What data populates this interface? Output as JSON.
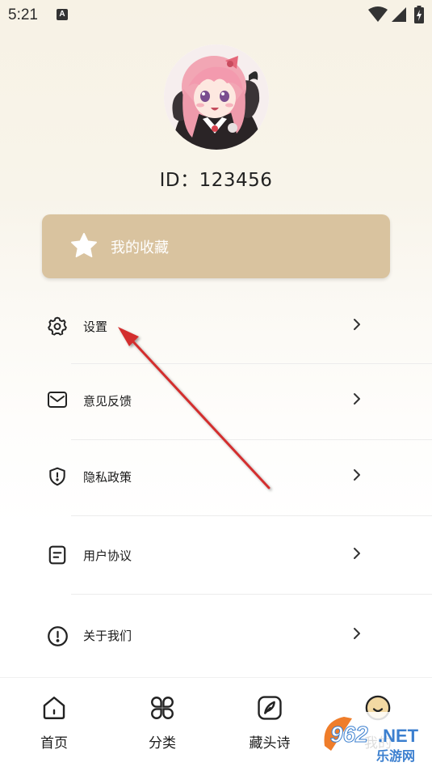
{
  "status_bar": {
    "time": "5:21",
    "notification_glyph": "A"
  },
  "profile": {
    "id_text": "ID：123456"
  },
  "favorites_card": {
    "label": "我的收藏",
    "color": "#d9c39f"
  },
  "menu": [
    {
      "key": "settings",
      "label": "设置",
      "icon": "gear-icon"
    },
    {
      "key": "feedback",
      "label": "意见反馈",
      "icon": "mail-icon"
    },
    {
      "key": "privacy",
      "label": "隐私政策",
      "icon": "shield-alert-icon"
    },
    {
      "key": "agreement",
      "label": "用户协议",
      "icon": "document-icon"
    },
    {
      "key": "about",
      "label": "关于我们",
      "icon": "info-circle-icon"
    }
  ],
  "bottom_nav": [
    {
      "key": "home",
      "label": "首页",
      "icon": "home-icon"
    },
    {
      "key": "category",
      "label": "分类",
      "icon": "clover-icon"
    },
    {
      "key": "acrostic",
      "label": "藏头诗",
      "icon": "feather-icon"
    },
    {
      "key": "mine",
      "label": "我的",
      "icon": "smile-face-icon",
      "active": true
    }
  ],
  "watermark": {
    "text_top": "962",
    "text_suffix": ".NET",
    "text_bottom": "乐游网"
  },
  "colors": {
    "accent_arrow": "#d32f2f",
    "active_tab": "#f3d9a3"
  }
}
